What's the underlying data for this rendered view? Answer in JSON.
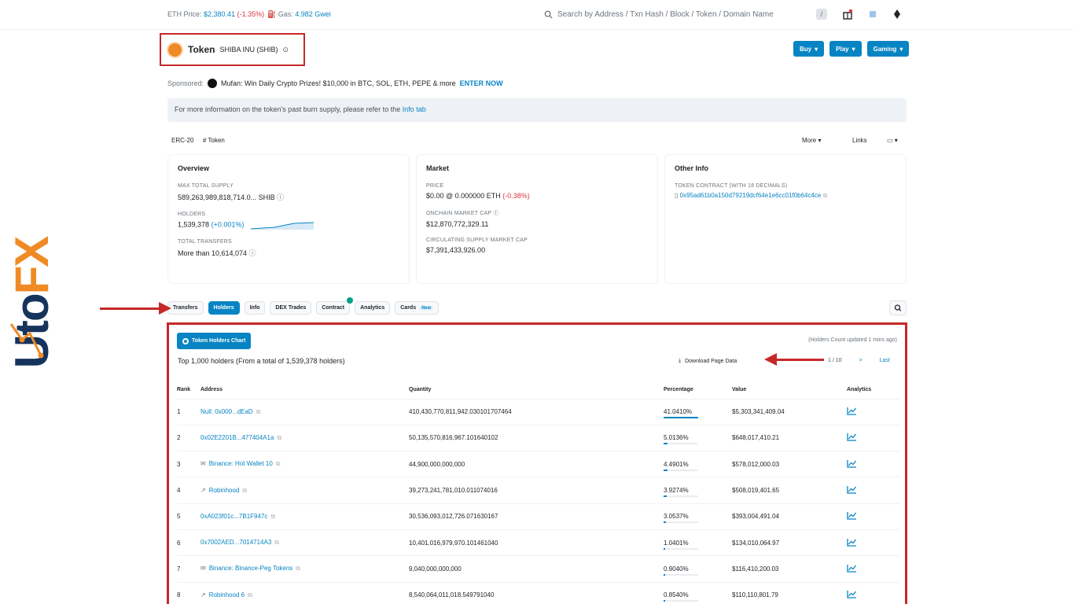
{
  "topbar": {
    "eth_label": "ETH Price:",
    "eth_price": "$2,380.41",
    "eth_change": "(-1.35%)",
    "gas_label": "Gas:",
    "gas_value": "4.982 Gwei",
    "search_placeholder": "Search by Address / Txn Hash / Block / Token / Domain Name",
    "slash_key": "/"
  },
  "header": {
    "title": "Token",
    "token_name": "SHIBA INU (SHIB)",
    "buttons": [
      "Buy",
      "Play",
      "Gaming"
    ]
  },
  "sponsored": {
    "label": "Sponsored:",
    "text": "Mufan: Win Daily Crypto Prizes! $10,000 in BTC, SOL, ETH, PEPE & more",
    "cta": "ENTER NOW"
  },
  "notice": {
    "text": "For more information on the token's past burn supply, please refer to the",
    "link": "Info tab"
  },
  "toolrow": {
    "left_a": "ERC-20",
    "left_b": "# Token",
    "right_a": "More",
    "right_b": "Links",
    "right_c": "More"
  },
  "overview": {
    "title": "Overview",
    "max_supply_label": "MAX TOTAL SUPPLY",
    "max_supply_value": "589,263,989,818,714.0...",
    "max_supply_unit": "SHIB",
    "holders_label": "HOLDERS",
    "holders_value": "1,539,378",
    "holders_change": "(+0.001%)",
    "transfers_label": "TOTAL TRANSFERS",
    "transfers_value": "More than 10,614,074"
  },
  "market": {
    "title": "Market",
    "price_label": "PRICE",
    "price_value": "$0.00 @ 0.000000 ETH",
    "price_change": "(-0.38%)",
    "mcap_label": "ONCHAIN MARKET CAP",
    "mcap_value": "$12,870,772,329.11",
    "cs_mcap_label": "CIRCULATING SUPPLY MARKET CAP",
    "cs_mcap_value": "$7,391,433,926.00"
  },
  "other_info": {
    "title": "Other Info",
    "contract_label": "TOKEN CONTRACT (WITH 18 DECIMALS)",
    "contract_value": "0x95ad61b0a150d79219dcf64e1e6cc01f0b64c4ce"
  },
  "tabs": [
    {
      "label": "Transfers",
      "active": false
    },
    {
      "label": "Holders",
      "active": true
    },
    {
      "label": "Info",
      "active": false
    },
    {
      "label": "DEX Trades",
      "active": false
    },
    {
      "label": "Contract",
      "active": false
    },
    {
      "label": "Analytics",
      "active": false
    },
    {
      "label": "Cards",
      "active": false
    }
  ],
  "cards_badge": "New",
  "holders": {
    "chart_button": "Token Holders Chart",
    "updated_note": "(Holders Count updated 1 mins ago)",
    "summary": "Top 1,000 holders (From a total of 1,539,378 holders)",
    "download": "Download Page Data",
    "page_info": "1 / 10",
    "page_next": ">",
    "page_last": "Last",
    "columns": [
      "Rank",
      "Address",
      "Quantity",
      "Percentage",
      "Value",
      "Analytics"
    ],
    "rows": [
      {
        "rank": "1",
        "icon": "",
        "address": "Null: 0x000...dEaD",
        "quantity": "410,430,770,811,942.030101707464",
        "percentage": "41.0410%",
        "pct_num": 41.04,
        "value": "$5,303,341,409.04"
      },
      {
        "rank": "2",
        "icon": "",
        "address": "0x02E2201B...477404A1a",
        "quantity": "50,135,570,816,967.101640102",
        "percentage": "5.0136%",
        "pct_num": 5.01,
        "value": "$648,017,410.21"
      },
      {
        "rank": "3",
        "icon": "✉",
        "address": "Binance: Hot Wallet 10",
        "quantity": "44,900,000,000,000",
        "percentage": "4.4901%",
        "pct_num": 4.49,
        "value": "$578,012,000.03"
      },
      {
        "rank": "4",
        "icon": "↗",
        "address": "Robinhood",
        "quantity": "39,273,241,781,010.011074016",
        "percentage": "3.9274%",
        "pct_num": 3.93,
        "value": "$508,019,401.65"
      },
      {
        "rank": "5",
        "icon": "",
        "address": "0xA023f01c...7B1F947c",
        "quantity": "30,536,093,012,726.071630167",
        "percentage": "3.0537%",
        "pct_num": 3.05,
        "value": "$393,004,491.04"
      },
      {
        "rank": "6",
        "icon": "",
        "address": "0x7002AED...7014714A3",
        "quantity": "10,401,016,979,970.101461040",
        "percentage": "1.0401%",
        "pct_num": 1.04,
        "value": "$134,010,064.97"
      },
      {
        "rank": "7",
        "icon": "✉",
        "address": "Binance: Binance-Peg Tokens",
        "quantity": "9,040,000,000,000",
        "percentage": "0.9040%",
        "pct_num": 0.9,
        "value": "$116,410,200.03"
      },
      {
        "rank": "8",
        "icon": "↗",
        "address": "Robinhood 6",
        "quantity": "8,540,064,011,018.549791040",
        "percentage": "0.8540%",
        "pct_num": 0.85,
        "value": "$110,110,801.79"
      }
    ]
  },
  "brand": {
    "text": "UtoFX"
  },
  "colors": {
    "accent": "#0784c3",
    "highlight": "#c62828",
    "brand_navy": "#16335c",
    "brand_orange": "#f08a24"
  }
}
